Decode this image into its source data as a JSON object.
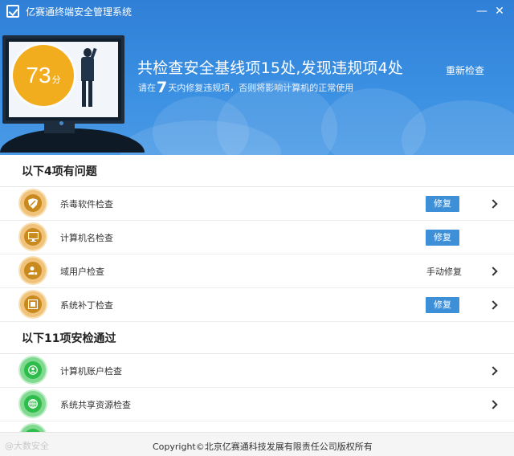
{
  "window": {
    "title": "亿赛通终端安全管理系统",
    "minimize_icon": "minimize-icon",
    "close_icon": "close-icon"
  },
  "banner": {
    "score": "73",
    "score_unit": "分",
    "headline": "共检查安全基线项15处,发现违规项4处",
    "subline_prefix": "请在",
    "subline_days": "7",
    "subline_suffix": "天内修复违规项，否则将影响计算机的正常使用",
    "recheck_label": "重新检查"
  },
  "issues": {
    "title": "以下4项有问题",
    "items": [
      {
        "label": "杀毒软件检查",
        "icon": "shield-icon",
        "action": "修复",
        "action_type": "button",
        "has_chevron": true
      },
      {
        "label": "计算机名检查",
        "icon": "monitor-icon",
        "action": "修复",
        "action_type": "button",
        "has_chevron": false
      },
      {
        "label": "域用户检查",
        "icon": "user-lock-icon",
        "action": "手动修复",
        "action_type": "text",
        "has_chevron": true
      },
      {
        "label": "系统补丁检查",
        "icon": "patch-icon",
        "action": "修复",
        "action_type": "button",
        "has_chevron": true
      }
    ]
  },
  "passed": {
    "title": "以下11项安检通过",
    "items": [
      {
        "label": "计算机账户检查",
        "icon": "user-circle-icon",
        "has_chevron": true
      },
      {
        "label": "系统共享资源检查",
        "icon": "share-icon",
        "has_chevron": true
      },
      {
        "label": "",
        "icon": "check-icon",
        "has_chevron": false
      }
    ]
  },
  "footer": {
    "copyright": "Copyright©北京亿赛通科技发展有限责任公司版权所有",
    "watermark": "@大数安全"
  },
  "colors": {
    "banner_blue": "#3a8fe2",
    "score_orange": "#f2ad1f",
    "fix_button": "#3d8fd8",
    "warn_icon": "#c8891f",
    "ok_icon": "#2ebc4a"
  }
}
